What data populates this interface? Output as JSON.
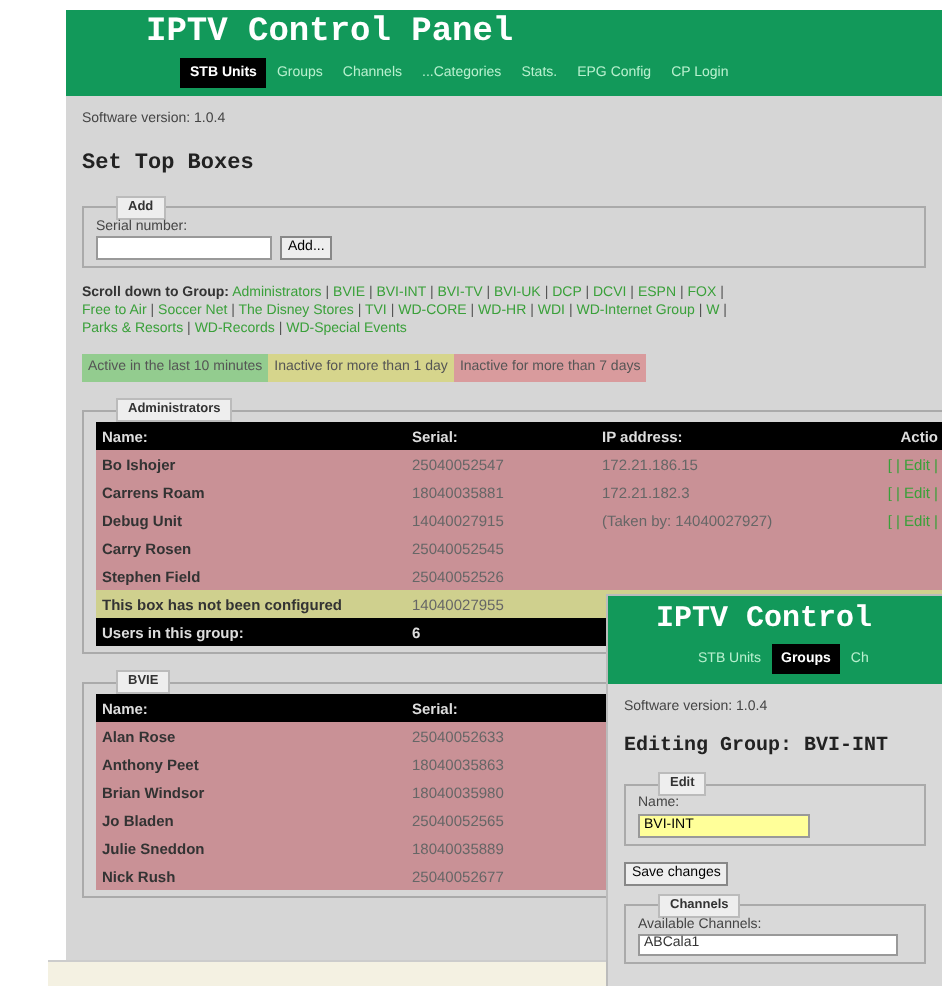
{
  "main": {
    "title": "IPTV Control Panel",
    "nav": [
      {
        "label": "STB Units",
        "selected": true
      },
      {
        "label": "Groups",
        "selected": false
      },
      {
        "label": "Channels",
        "selected": false
      },
      {
        "label": "...Categories",
        "selected": false
      },
      {
        "label": "Stats.",
        "selected": false
      },
      {
        "label": "EPG Config",
        "selected": false
      },
      {
        "label": "CP Login",
        "selected": false
      }
    ],
    "software_version": "Software version: 1.0.4",
    "heading": "Set Top Boxes",
    "add": {
      "legend": "Add",
      "label": "Serial number:",
      "button": "Add..."
    },
    "scroll": {
      "label": "Scroll down to Group:",
      "separator": "|",
      "lines": [
        [
          "Administrators",
          "BVIE",
          "BVI-INT",
          "BVI-TV",
          "BVI-UK",
          "DCP",
          "DCVI",
          "ESPN",
          "FOX"
        ],
        [
          "Free to Air",
          "Soccer Net",
          "The Disney Stores",
          "TVI",
          "WD-CORE",
          "WD-HR",
          "WDI",
          "WD-Internet Group",
          "W"
        ],
        [
          "Parks & Resorts",
          "WD-Records",
          "WD-Special Events"
        ]
      ]
    },
    "status_legend": [
      {
        "label": "Active in the last 10 minutes",
        "color": "#93cc8f"
      },
      {
        "label": "Inactive for more than 1 day",
        "color": "#d6d58c"
      },
      {
        "label": "Inactive for more than 7 days",
        "color": "#d99b9d"
      }
    ],
    "groups": [
      {
        "legend": "Administrators",
        "columns": [
          "Name:",
          "Serial:",
          "IP address:",
          "Actio"
        ],
        "rows": [
          {
            "color": "#c99196",
            "cells": [
              "Bo Ishojer",
              "25040052547",
              "172.21.186.15",
              "[ | Edit |"
            ]
          },
          {
            "color": "#c99196",
            "cells": [
              "Carrens Roam",
              "18040035881",
              "172.21.182.3",
              "[ | Edit |"
            ]
          },
          {
            "color": "#c99196",
            "cells": [
              "Debug Unit",
              "14040027915",
              "(Taken by: 14040027927)",
              "[ | Edit |"
            ]
          },
          {
            "color": "#c99196",
            "cells": [
              "Carry Rosen",
              "25040052545"
            ]
          },
          {
            "color": "#c99196",
            "cells": [
              "Stephen Field",
              "25040052526"
            ]
          },
          {
            "color": "#cfd08e",
            "cells": [
              "This box has not been configured",
              "14040027955"
            ]
          }
        ],
        "footer": [
          "Users in this group:",
          "6"
        ]
      },
      {
        "legend": "BVIE",
        "columns": [
          "Name:",
          "Serial:"
        ],
        "rows": [
          {
            "color": "#c99196",
            "cells": [
              "Alan Rose",
              "25040052633"
            ]
          },
          {
            "color": "#c99196",
            "cells": [
              "Anthony Peet",
              "18040035863"
            ]
          },
          {
            "color": "#c99196",
            "cells": [
              "Brian Windsor",
              "18040035980"
            ]
          },
          {
            "color": "#c99196",
            "cells": [
              "Jo Bladen",
              "25040052565"
            ]
          },
          {
            "color": "#c99196",
            "cells": [
              "Julie Sneddon",
              "18040035889"
            ]
          },
          {
            "color": "#c99196",
            "cells": [
              "Nick Rush",
              "25040052677"
            ]
          }
        ]
      }
    ]
  },
  "editor": {
    "title": "IPTV Control",
    "nav": [
      {
        "label": "STB Units",
        "selected": false
      },
      {
        "label": "Groups",
        "selected": true
      },
      {
        "label": "Ch",
        "selected": false
      }
    ],
    "software_version": "Software version: 1.0.4",
    "heading": "Editing Group: BVI-INT",
    "edit": {
      "legend": "Edit",
      "label": "Name:",
      "value": "BVI-INT"
    },
    "save_button": "Save changes",
    "channels": {
      "legend": "Channels",
      "label": "Available Channels:",
      "items": [
        "ABCala1"
      ]
    }
  }
}
